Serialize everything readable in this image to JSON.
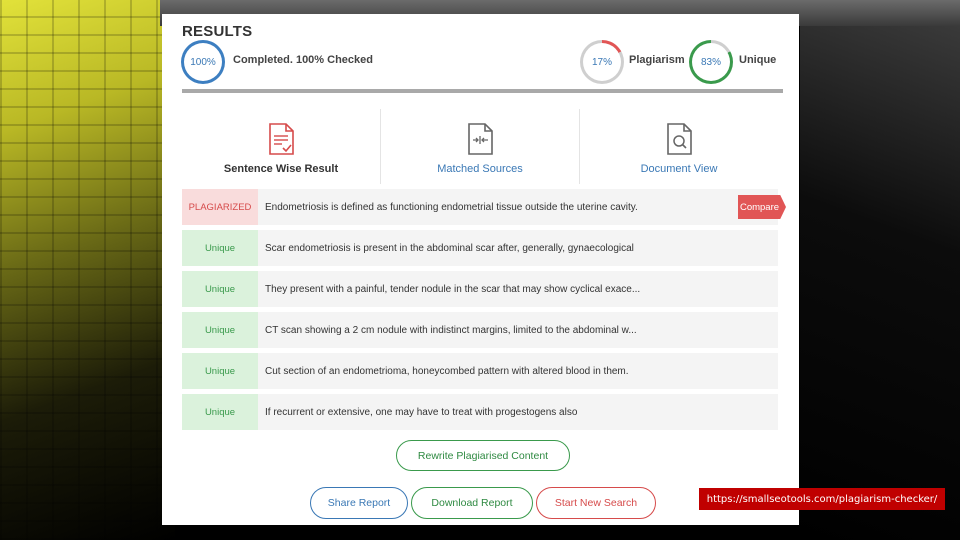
{
  "header": {
    "title": "RESULTS"
  },
  "stats": {
    "completed_percent": "100%",
    "completed_label": "Completed. 100% Checked",
    "plagiarism_percent": "17%",
    "plagiarism_label": "Plagiarism",
    "unique_percent": "83%",
    "unique_label": "Unique",
    "plagiarism_value": 17,
    "unique_value": 83
  },
  "views": [
    {
      "label": "Sentence Wise Result",
      "icon": "document-check-icon"
    },
    {
      "label": "Matched Sources",
      "icon": "document-compare-icon"
    },
    {
      "label": "Document View",
      "icon": "document-search-icon"
    }
  ],
  "rows": [
    {
      "status": "PLAGIARIZED",
      "text": "Endometriosis is defined as functioning endometrial tissue outside the uterine cavity."
    },
    {
      "status": "Unique",
      "text": "Scar endometriosis is present in the abdominal scar after, generally, gynaecological"
    },
    {
      "status": "Unique",
      "text": "They present with a painful, tender nodule in the scar that may show cyclical exace..."
    },
    {
      "status": "Unique",
      "text": "CT scan showing a 2 cm nodule with indistinct margins, limited to the abdominal w..."
    },
    {
      "status": "Unique",
      "text": "Cut section of an endometrioma, honeycombed pattern with altered blood in them."
    },
    {
      "status": "Unique",
      "text": "If recurrent or extensive, one may have to treat with progestogens also"
    }
  ],
  "compare_label": "Compare",
  "actions": {
    "rewrite": "Rewrite Plagiarised Content",
    "share": "Share Report",
    "download": "Download Report",
    "new_search": "Start New Search"
  },
  "source_url": "https://smallseotools.com/plagiarism-checker/",
  "colors": {
    "plagiarized": "#e15555",
    "unique": "#3a9a4c",
    "accent_blue": "#3a78b5"
  }
}
